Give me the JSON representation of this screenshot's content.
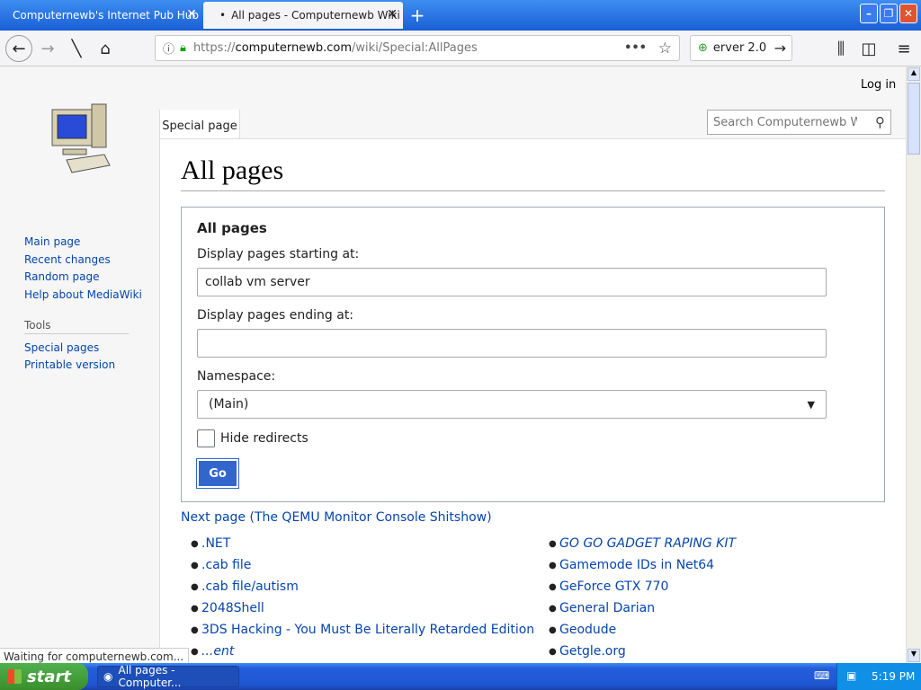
{
  "browser": {
    "tabs": [
      {
        "title": "Computernewb's Internet Pub Hub",
        "active": false
      },
      {
        "title": "All pages - Computernewb Wiki",
        "active": true
      }
    ],
    "url_prefix": "https://",
    "url_domain": "computernewb.com",
    "url_path": "/wiki/Special:AllPages",
    "extension_text": "erver 2.0",
    "status_text": "Waiting for computernewb.com..."
  },
  "sidebar": {
    "nav": [
      "Main page",
      "Recent changes",
      "Random page",
      "Help about MediaWiki"
    ],
    "tools_heading": "Tools",
    "tools": [
      "Special pages",
      "Printable version"
    ]
  },
  "header": {
    "login": "Log in",
    "tab_label": "Special page",
    "search_placeholder": "Search Computernewb Wiki"
  },
  "main": {
    "title": "All pages",
    "form": {
      "legend": "All pages",
      "start_label": "Display pages starting at:",
      "start_value": "collab vm server",
      "end_label": "Display pages ending at:",
      "end_value": "",
      "namespace_label": "Namespace:",
      "namespace_value": "(Main)",
      "hide_redirects_label": "Hide redirects",
      "hide_redirects_checked": false,
      "go_label": "Go"
    },
    "next_page": "Next page (The QEMU Monitor Console Shitshow)",
    "col1": [
      ".NET",
      ".cab file",
      ".cab file/autism",
      "2048Shell",
      "3DS Hacking - You Must Be Literally Retarded Edition",
      "...ent"
    ],
    "col2": [
      "GO GO GADGET RAPING KIT",
      "Gamemode IDs in Net64",
      "GeForce GTX 770",
      "General Darian",
      "Geodude",
      "Getgle.org"
    ],
    "col2_italic_index": 0
  },
  "taskbar": {
    "start_label": "start",
    "task_label": "All pages - Computer...",
    "clock": "5:19 PM"
  },
  "colors": {
    "link": "#0645ad",
    "go_button": "#3366cc",
    "taskbar": "#245edb",
    "start_button": "#3a8f2c"
  }
}
